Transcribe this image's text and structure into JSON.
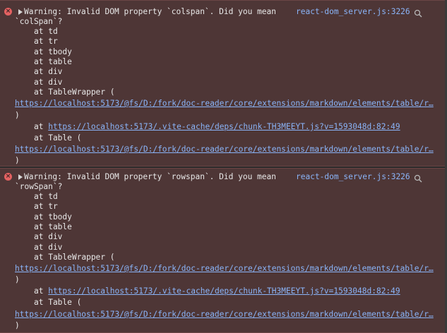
{
  "entries": [
    {
      "message_line1": "Warning: Invalid DOM property `colspan`. Did you mean",
      "message_line2": "`colSpan`?",
      "source": "react-dom_server.js:3226",
      "frames": [
        "at td",
        "at tr",
        "at tbody",
        "at table",
        "at div",
        "at div",
        "at TableWrapper ("
      ],
      "url1": "https://localhost:5173/@fs/D:/fork/doc-reader/core/extensions/markdown/elements/table/r…",
      "close1": ")",
      "chunk_prefix": "at ",
      "chunk_url": "https://localhost:5173/.vite-cache/deps/chunk-TH3MEEYT.js?v=1593048d:82:49",
      "table_frame": "at Table (",
      "url2": "https://localhost:5173/@fs/D:/fork/doc-reader/core/extensions/markdown/elements/table/r…",
      "close2": ")"
    },
    {
      "message_line1": "Warning: Invalid DOM property `rowspan`. Did you mean",
      "message_line2": "`rowSpan`?",
      "source": "react-dom_server.js:3226",
      "frames": [
        "at td",
        "at tr",
        "at tbody",
        "at table",
        "at div",
        "at div",
        "at TableWrapper ("
      ],
      "url1": "https://localhost:5173/@fs/D:/fork/doc-reader/core/extensions/markdown/elements/table/r…",
      "close1": ")",
      "chunk_prefix": "at ",
      "chunk_url": "https://localhost:5173/.vite-cache/deps/chunk-TH3MEEYT.js?v=1593048d:82:49",
      "table_frame": "at Table (",
      "url2": "https://localhost:5173/@fs/D:/fork/doc-reader/core/extensions/markdown/elements/table/r…",
      "close2": ")"
    }
  ],
  "icons": {
    "error": "error-icon",
    "expand": "expand-caret-icon",
    "search": "search-icon"
  },
  "colors": {
    "entry_bg": "#4e3636",
    "link": "#8ab4f8",
    "error_icon": "#e46262",
    "text": "#e8e8e8"
  }
}
